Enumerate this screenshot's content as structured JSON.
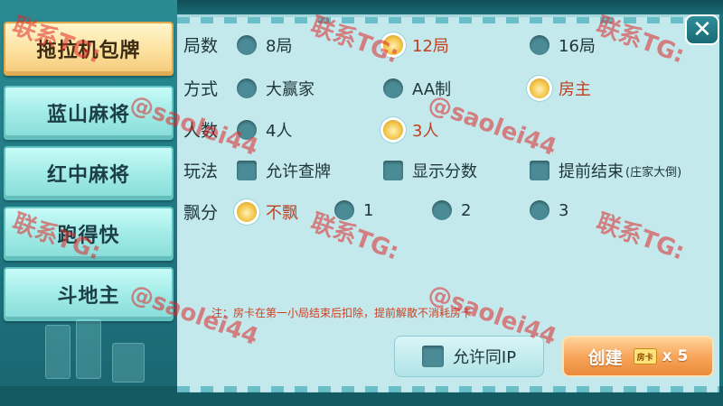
{
  "sidebar": {
    "items": [
      {
        "label": "拖拉机包牌",
        "active": true
      },
      {
        "label": "蓝山麻将",
        "active": false
      },
      {
        "label": "红中麻将",
        "active": false
      },
      {
        "label": "跑得快",
        "active": false
      },
      {
        "label": "斗地主",
        "active": false
      }
    ]
  },
  "close": {
    "glyph": "✕",
    "icon": "close-icon"
  },
  "rounds": {
    "label": "局数",
    "options": [
      {
        "label": "8局",
        "selected": false
      },
      {
        "label": "12局",
        "selected": true
      },
      {
        "label": "16局",
        "selected": false
      }
    ]
  },
  "mode": {
    "label": "方式",
    "options": [
      {
        "label": "大赢家",
        "selected": false
      },
      {
        "label": "AA制",
        "selected": false
      },
      {
        "label": "房主",
        "selected": true
      }
    ]
  },
  "players": {
    "label": "人数",
    "options": [
      {
        "label": "4人",
        "selected": false
      },
      {
        "label": "3人",
        "selected": true
      }
    ]
  },
  "rules": {
    "label": "玩法",
    "options": [
      {
        "label": "允许查牌",
        "checked": false
      },
      {
        "label": "显示分数",
        "checked": false
      },
      {
        "label": "提前结束",
        "sub": "(庄家大倒)",
        "checked": false
      }
    ]
  },
  "float": {
    "label": "飘分",
    "options": [
      {
        "label": "不飘",
        "selected": true
      },
      {
        "label": "1",
        "selected": false
      },
      {
        "label": "2",
        "selected": false
      },
      {
        "label": "3",
        "selected": false
      }
    ]
  },
  "note": "注：房卡在第一小局结束后扣除，提前解散不消耗房卡",
  "same_ip": {
    "label": "允许同IP",
    "checked": false
  },
  "create": {
    "label": "创建",
    "card_text": "房卡",
    "multiplier": "x 5"
  },
  "watermark": {
    "line1": "联系TG:",
    "line2": "@saolei44"
  },
  "colors": {
    "accent_selected_text": "#c0401f",
    "note_text": "#cf3f1f",
    "panel_bg": "#c3e9ed",
    "active_tab": "#fde3a2",
    "watermark": "#de2828"
  }
}
